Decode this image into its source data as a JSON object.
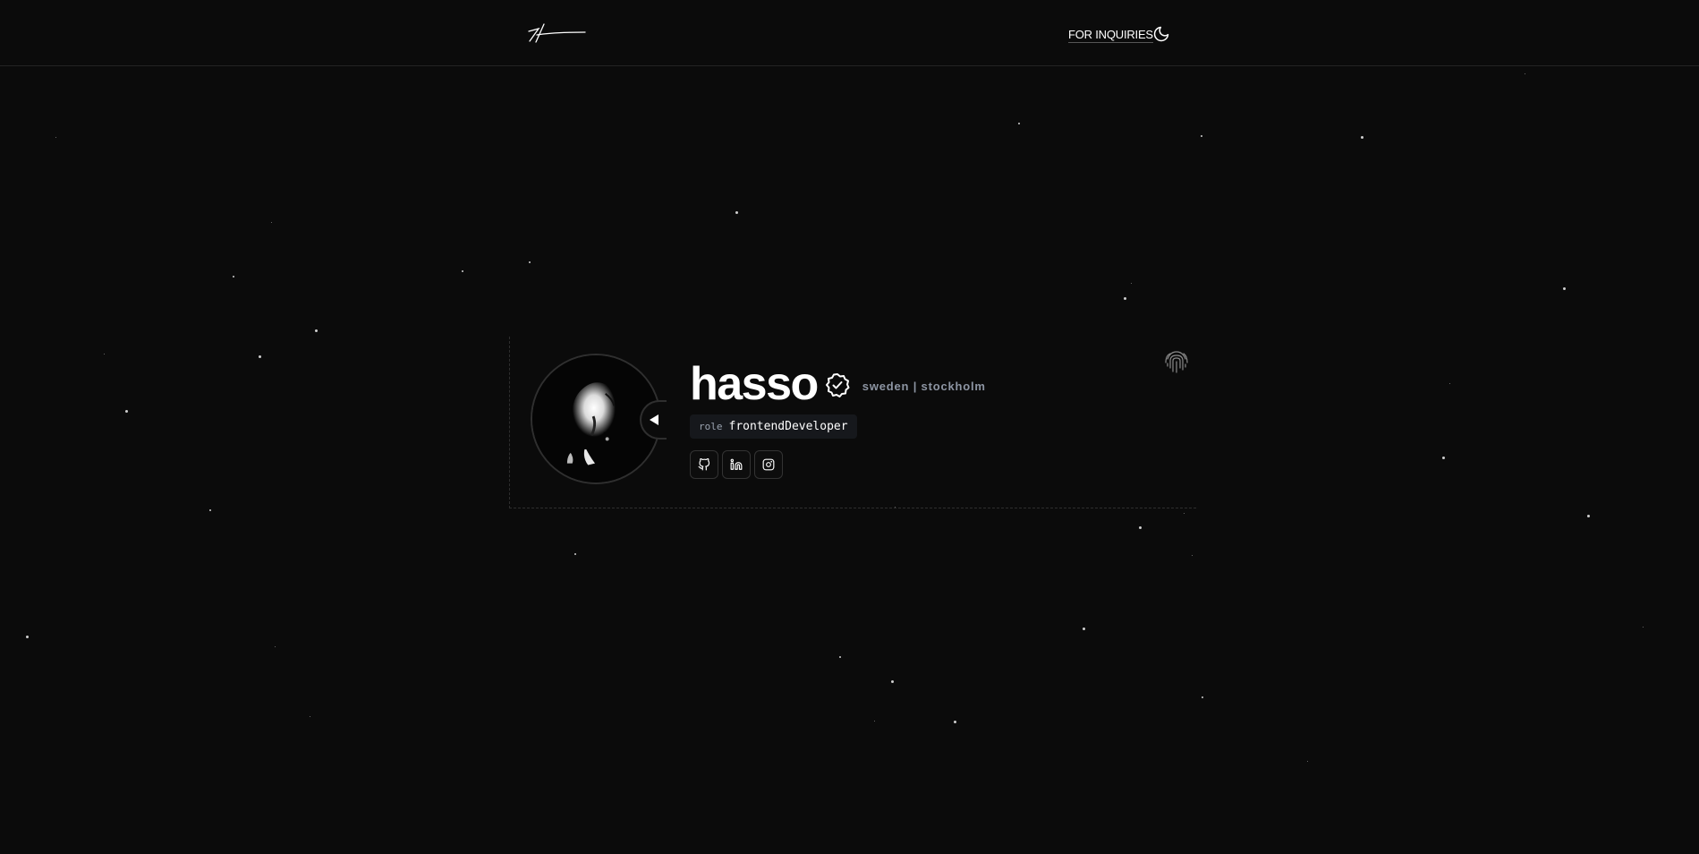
{
  "header": {
    "logo_icon": "signature-logo-icon",
    "inquiries_label": "FOR INQUIRIES",
    "theme_icon": "moon-icon"
  },
  "profile": {
    "name": "hasso",
    "verified_icon": "verified-badge-icon",
    "location": "sweden | stockholm",
    "role_key": "role",
    "role_value": "frontendDeveloper",
    "avatar_toggle_icon": "play-left-icon",
    "fingerprint_icon": "fingerprint-icon",
    "socials": [
      {
        "icon": "github-icon"
      },
      {
        "icon": "linkedin-icon"
      },
      {
        "icon": "instagram-icon"
      }
    ]
  },
  "colors": {
    "background": "#0b0b0b",
    "text": "#ffffff",
    "muted": "#8d95a3",
    "chip_bg": "#16181c",
    "border": "#333333"
  }
}
